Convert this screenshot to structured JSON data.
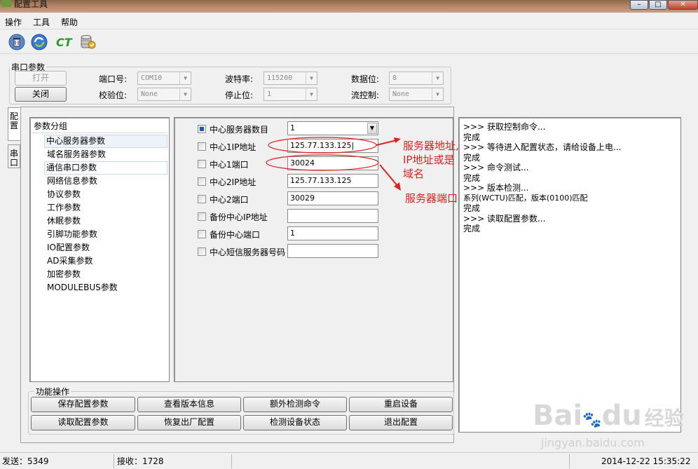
{
  "window": {
    "title": "配置工具"
  },
  "menu": [
    "操作",
    "工具",
    "帮助"
  ],
  "toolbar": {
    "icons": [
      "trash-icon",
      "refresh-icon",
      "ct-icon",
      "database-icon"
    ],
    "ct_label": "CT"
  },
  "serial": {
    "legend": "串口参数",
    "open_button": "打开",
    "close_button": "关闭",
    "port_label": "端口号:",
    "port_value": "COM10",
    "baud_label": "波特率:",
    "baud_value": "115200",
    "databits_label": "数据位:",
    "databits_value": "8",
    "parity_label": "校验位:",
    "parity_value": "None",
    "stopbits_label": "停止位:",
    "stopbits_value": "1",
    "flow_label": "流控制:",
    "flow_value": "None"
  },
  "tabs": {
    "config": "配置",
    "serial": "串口"
  },
  "tree": {
    "header": "参数分组",
    "items": [
      "中心服务器参数",
      "域名服务器参数",
      "通信串口参数",
      "网络信息参数",
      "协议参数",
      "工作参数",
      "休眠参数",
      "引脚功能参数",
      "IO配置参数",
      "AD采集参数",
      "加密参数",
      "MODULEBUS参数"
    ]
  },
  "params": [
    {
      "label": "中心服务器数目",
      "value": "1",
      "checked": true,
      "type": "select"
    },
    {
      "label": "中心1IP地址",
      "value": "125.77.133.125|",
      "checked": false,
      "type": "text"
    },
    {
      "label": "中心1端口",
      "value": "30024",
      "checked": false,
      "type": "text"
    },
    {
      "label": "中心2IP地址",
      "value": "125.77.133.125",
      "checked": false,
      "type": "text"
    },
    {
      "label": "中心2端口",
      "value": "30029",
      "checked": false,
      "type": "text"
    },
    {
      "label": "备份中心IP地址",
      "value": "",
      "checked": false,
      "type": "text"
    },
    {
      "label": "备份中心端口",
      "value": "1",
      "checked": false,
      "type": "text"
    },
    {
      "label": "中心短信服务器号码",
      "value": "",
      "checked": false,
      "type": "text"
    }
  ],
  "annotations": {
    "server_addr_1": "服务器地址,",
    "server_addr_2": "IP地址或是",
    "server_addr_3": "域名",
    "server_port": "服务器端口"
  },
  "log": [
    ">>> 获取控制命令...",
    "完成",
    ">>> 等待进入配置状态，请给设备上电...",
    "完成",
    ">>> 命令测试...",
    "完成",
    ">>> 版本检测...",
    "系列(WCTU)匹配，版本(0100)匹配",
    "完成",
    ">>> 读取配置参数...",
    "完成"
  ],
  "functions": {
    "legend": "功能操作",
    "buttons": [
      "保存配置参数",
      "查看版本信息",
      "额外检测命令",
      "重启设备",
      "读取配置参数",
      "恢复出厂配置",
      "检测设备状态",
      "退出配置"
    ]
  },
  "status": {
    "sent": "发送：5349",
    "received": "接收：1728",
    "datetime": "2014-12-22 15:35:22"
  },
  "watermark": {
    "brand": "Bai",
    "brand2": "du",
    "brand3": "经验",
    "url": "jingyan.baidu.com"
  }
}
